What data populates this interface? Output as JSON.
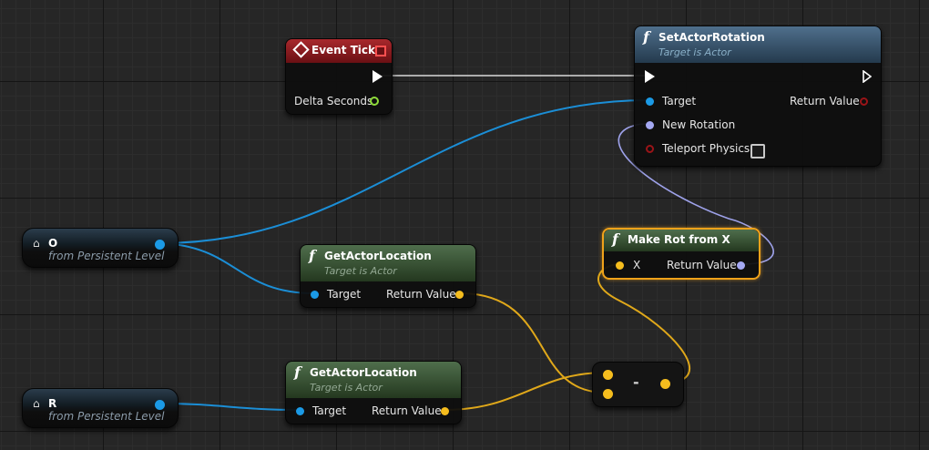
{
  "nodes": {
    "event_tick": {
      "title": "Event Tick",
      "delta_seconds": "Delta Seconds"
    },
    "set_actor_rotation": {
      "title": "SetActorRotation",
      "subtitle": "Target is Actor",
      "target": "Target",
      "return_value": "Return Value",
      "new_rotation": "New Rotation",
      "teleport_physics": "Teleport Physics"
    },
    "make_rot_from_x": {
      "title": "Make Rot from X",
      "x": "X",
      "return_value": "Return Value"
    },
    "get_actor_location_1": {
      "title": "GetActorLocation",
      "subtitle": "Target is Actor",
      "target": "Target",
      "return_value": "Return Value"
    },
    "get_actor_location_2": {
      "title": "GetActorLocation",
      "subtitle": "Target is Actor",
      "target": "Target",
      "return_value": "Return Value"
    },
    "subtract": {
      "symbol": "-"
    },
    "actor_o": {
      "name": "O",
      "subtitle": "from Persistent Level"
    },
    "actor_r": {
      "name": "R",
      "subtitle": "from Persistent Level"
    }
  },
  "colors": {
    "exec": "#ffffff",
    "object": "#1b9ae6",
    "vector": "#f5bd1e",
    "rotator": "#a4a8f2",
    "bool": "#9a1418",
    "float": "#8fdc3a",
    "selection": "#f0a21a"
  }
}
